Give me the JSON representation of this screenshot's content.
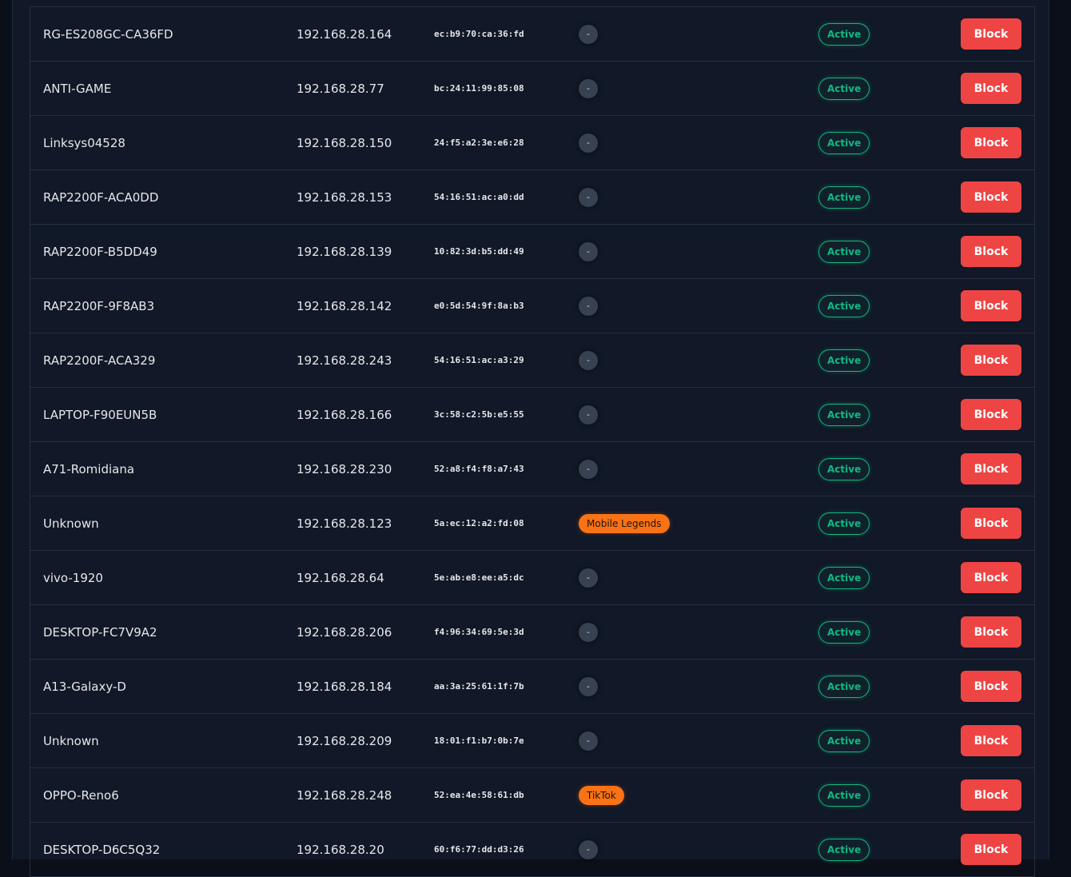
{
  "colors": {
    "background": "#111827",
    "status_active": "#10b981",
    "block_button": "#ef4444",
    "app_tag": "#f97316"
  },
  "devices": [
    {
      "name": "RG-ES208GC-CA36FD",
      "ip": "192.168.28.164",
      "mac": "ec:b9:70:ca:36:fd",
      "app": "-",
      "status": "Active",
      "action": "Block"
    },
    {
      "name": "ANTI-GAME",
      "ip": "192.168.28.77",
      "mac": "bc:24:11:99:85:08",
      "app": "-",
      "status": "Active",
      "action": "Block"
    },
    {
      "name": "Linksys04528",
      "ip": "192.168.28.150",
      "mac": "24:f5:a2:3e:e6:28",
      "app": "-",
      "status": "Active",
      "action": "Block"
    },
    {
      "name": "RAP2200F-ACA0DD",
      "ip": "192.168.28.153",
      "mac": "54:16:51:ac:a0:dd",
      "app": "-",
      "status": "Active",
      "action": "Block"
    },
    {
      "name": "RAP2200F-B5DD49",
      "ip": "192.168.28.139",
      "mac": "10:82:3d:b5:dd:49",
      "app": "-",
      "status": "Active",
      "action": "Block"
    },
    {
      "name": "RAP2200F-9F8AB3",
      "ip": "192.168.28.142",
      "mac": "e0:5d:54:9f:8a:b3",
      "app": "-",
      "status": "Active",
      "action": "Block"
    },
    {
      "name": "RAP2200F-ACA329",
      "ip": "192.168.28.243",
      "mac": "54:16:51:ac:a3:29",
      "app": "-",
      "status": "Active",
      "action": "Block"
    },
    {
      "name": "LAPTOP-F90EUN5B",
      "ip": "192.168.28.166",
      "mac": "3c:58:c2:5b:e5:55",
      "app": "-",
      "status": "Active",
      "action": "Block"
    },
    {
      "name": "A71-Romidiana",
      "ip": "192.168.28.230",
      "mac": "52:a8:f4:f8:a7:43",
      "app": "-",
      "status": "Active",
      "action": "Block"
    },
    {
      "name": "Unknown",
      "ip": "192.168.28.123",
      "mac": "5a:ec:12:a2:fd:08",
      "app": "Mobile Legends",
      "status": "Active",
      "action": "Block"
    },
    {
      "name": "vivo-1920",
      "ip": "192.168.28.64",
      "mac": "5e:ab:e8:ee:a5:dc",
      "app": "-",
      "status": "Active",
      "action": "Block"
    },
    {
      "name": "DESKTOP-FC7V9A2",
      "ip": "192.168.28.206",
      "mac": "f4:96:34:69:5e:3d",
      "app": "-",
      "status": "Active",
      "action": "Block"
    },
    {
      "name": "A13-Galaxy-D",
      "ip": "192.168.28.184",
      "mac": "aa:3a:25:61:1f:7b",
      "app": "-",
      "status": "Active",
      "action": "Block"
    },
    {
      "name": "Unknown",
      "ip": "192.168.28.209",
      "mac": "18:01:f1:b7:0b:7e",
      "app": "-",
      "status": "Active",
      "action": "Block"
    },
    {
      "name": "OPPO-Reno6",
      "ip": "192.168.28.248",
      "mac": "52:ea:4e:58:61:db",
      "app": "TikTok",
      "status": "Active",
      "action": "Block"
    },
    {
      "name": "DESKTOP-D6C5Q32",
      "ip": "192.168.28.20",
      "mac": "60:f6:77:dd:d3:26",
      "app": "-",
      "status": "Active",
      "action": "Block"
    }
  ]
}
